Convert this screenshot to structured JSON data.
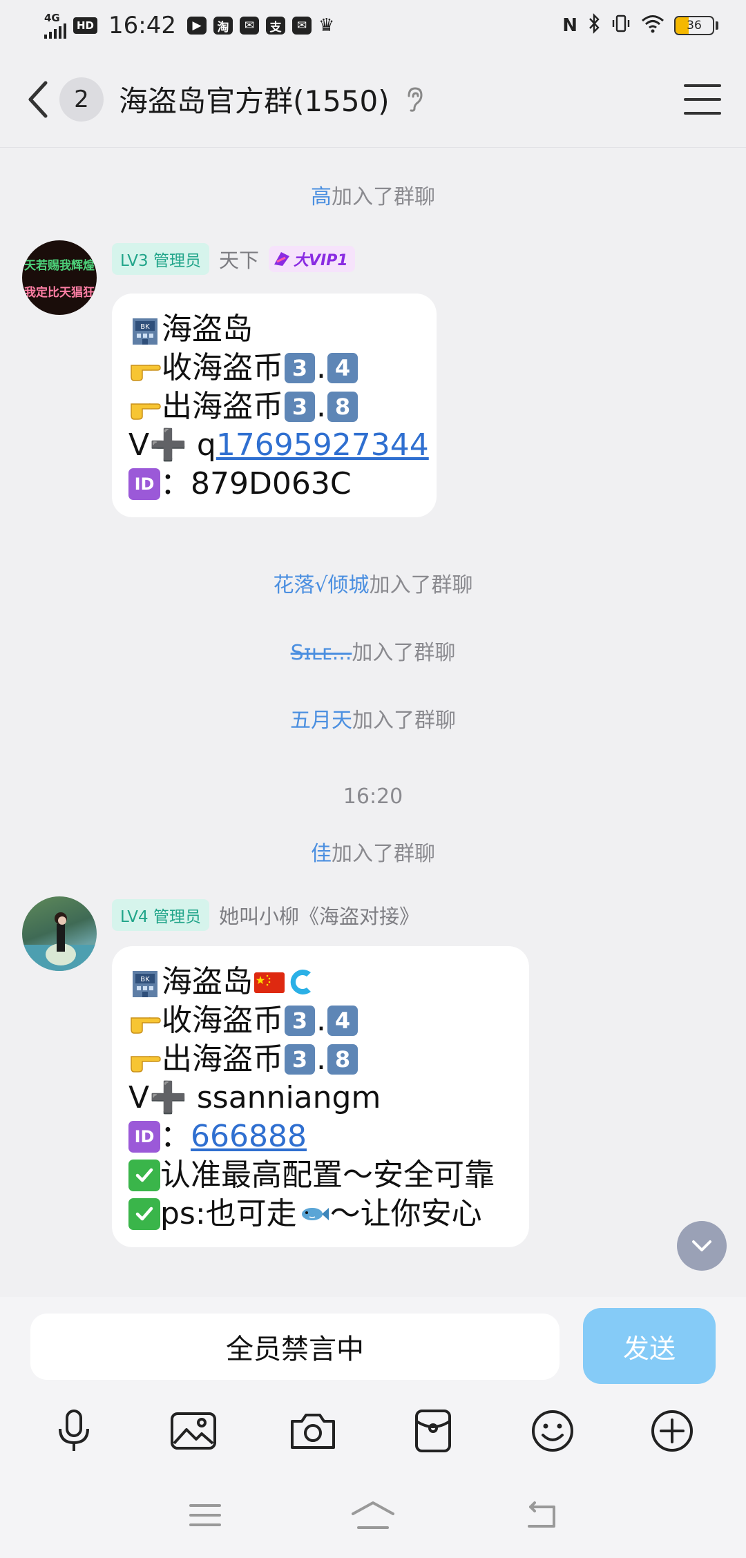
{
  "status_bar": {
    "network": "4G",
    "hd": "HD",
    "time": "16:42",
    "app_icons": [
      "play-icon",
      "taobao-icon",
      "mail-icon",
      "alipay-icon",
      "message-icon",
      "crown-icon"
    ],
    "app_icon_labels": [
      "▶",
      "淘",
      "✉",
      "支",
      "✉"
    ],
    "battery": "36"
  },
  "header": {
    "unread_count": "2",
    "title": "海盗岛官方群(1550)"
  },
  "chat": {
    "join_suffix": "加入了群聊",
    "events": [
      {
        "name": "高"
      },
      {
        "name": "花落√倾城"
      },
      {
        "name": "Sɪʟᴇ..."
      },
      {
        "name": "五月天"
      },
      {
        "name": "佳"
      }
    ],
    "timestamp": "16:20",
    "messages": [
      {
        "avatar_text_1": "天若赐我辉煌",
        "avatar_text_2": "我定比天猖狂",
        "level": "LV3 管理员",
        "sender": "天下",
        "vip": "大VIP1",
        "lines": {
          "l1": "海盗岛",
          "l2_text": "收海盗币 ",
          "l2_a": "3",
          "l2_dot": ".",
          "l2_b": "4",
          "l3_text": "出海盗币 ",
          "l3_a": "3",
          "l3_dot": ".",
          "l3_b": "8",
          "l4_prefix": "V➕ q",
          "l4_link": "17695927344",
          "l5_colon": "：",
          "l5_text": " 879D063C"
        }
      },
      {
        "level": "LV4 管理员",
        "sender": "她叫小柳《海盗对接》",
        "lines": {
          "l1": "海盗岛",
          "l2_text": "收海盗币 ",
          "l2_a": "3",
          "l2_dot": ".",
          "l2_b": "4",
          "l3_text": "出海盗币 ",
          "l3_a": "3",
          "l3_dot": ".",
          "l3_b": "8",
          "l4": "V➕ ssanniangm",
          "l5_colon": "： ",
          "l5_link": "666888",
          "l6": "认准最高配置～安全可靠",
          "l7_a": "ps:也可走",
          "l7_b": "～让你安心"
        }
      }
    ]
  },
  "input": {
    "muted_text": "全员禁言中",
    "send_label": "发送"
  },
  "toolbar": [
    "microphone-icon",
    "image-icon",
    "camera-icon",
    "red-packet-icon",
    "emoji-icon",
    "plus-icon"
  ],
  "colors": {
    "accent_link": "#2f6fd0",
    "name_blue": "#4b8fe0",
    "send_button": "#85cbf7",
    "level_tag_bg": "#d6f4ec",
    "level_tag_text": "#21a58a"
  }
}
